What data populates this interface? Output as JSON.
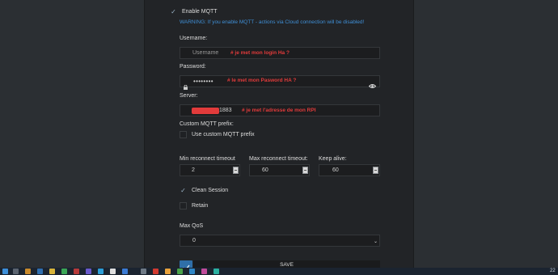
{
  "mqtt": {
    "enable_label": "Enable MQTT",
    "enable_checked": true,
    "warning": "WARNING: If you enable MQTT - actions via Cloud connection will be disabled!"
  },
  "username": {
    "label": "Username:",
    "placeholder": "Username",
    "annotation": "# je met mon login  Ha ?"
  },
  "password": {
    "label": "Password:",
    "value": "••••••••",
    "annotation": "# le met mon Pasword HA ?"
  },
  "server": {
    "label": "Server:",
    "value_suffix": "1883",
    "annotation": "# je met l'adresse de mon RPI"
  },
  "prefix": {
    "label": "Custom MQTT prefix:",
    "checkbox_label": "Use custom MQTT prefix",
    "checked": false
  },
  "timeouts": {
    "min_label": "Min reconnect timeout",
    "min_value": "2",
    "max_label": "Max reconnect timeout:",
    "max_value": "60",
    "keepalive_label": "Keep alive:",
    "keepalive_value": "60"
  },
  "clean_session": {
    "label": "Clean Session",
    "checked": true
  },
  "retain": {
    "label": "Retain",
    "checked": false
  },
  "qos": {
    "label": "Max QoS",
    "value": "0"
  },
  "save": {
    "label": "SAVE"
  },
  "colors": {
    "warning": "#3f8fd6",
    "annotation": "#e23b3b",
    "panel": "#222427"
  },
  "taskbar": {
    "clock": "22"
  }
}
